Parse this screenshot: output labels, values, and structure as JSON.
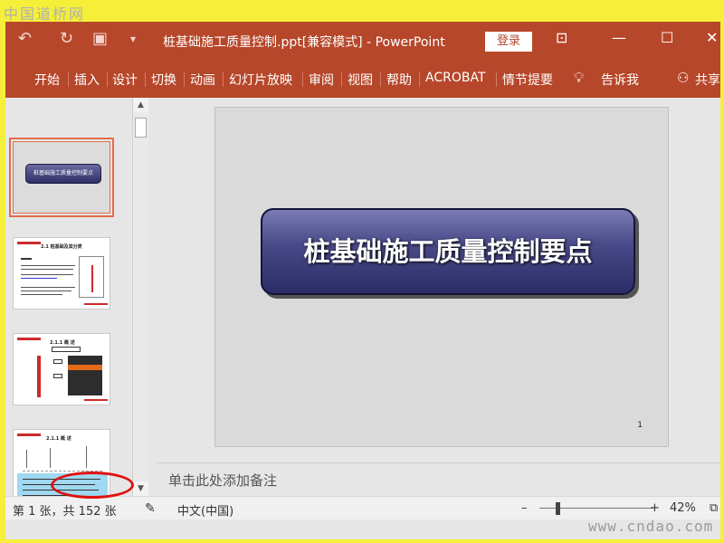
{
  "watermark_top": "中国道桥网",
  "watermark_bottom": "www.cndao.com",
  "titlebar": {
    "title": "桩基础施工质量控制.ppt[兼容模式]  -  PowerPoint",
    "login": "登录",
    "qat_undo": "↶",
    "qat_redo": "↻",
    "qat_present": "▣",
    "qat_customize": "▾",
    "ribbon_display": "⊡",
    "minimize": "—",
    "maximize": "☐",
    "close": "✕"
  },
  "ribbon": {
    "tabs": [
      "开始",
      "插入",
      "设计",
      "切换",
      "动画",
      "幻灯片放映",
      "审阅",
      "视图",
      "帮助",
      "ACROBAT",
      "情节提要"
    ],
    "tell_me": "告诉我",
    "share": "共享"
  },
  "slide": {
    "title": "桩基础施工质量控制要点",
    "number": "1"
  },
  "thumbnails": {
    "t1_title": "桩基础施工质量控制要点",
    "t2_heading": "2.1 桩基础及其分类",
    "t3_heading": "2.1.1 概 述",
    "t4_heading": "2.1.1 概 述"
  },
  "notes": {
    "placeholder": "单击此处添加备注"
  },
  "statusbar": {
    "slide_counter": "第 1 张，共 152 张",
    "language": "中文(中国)",
    "zoom_minus": "–",
    "zoom_plus": "+",
    "zoom": "42%"
  },
  "colors": {
    "accent": "#b7472a",
    "highlight": "#e01010",
    "title_box": "#3b3b78"
  }
}
